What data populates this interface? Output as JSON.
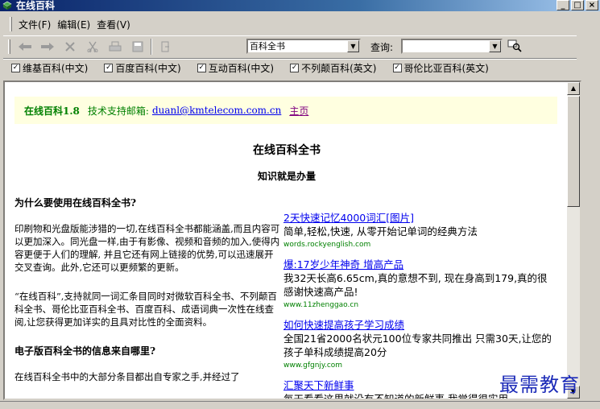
{
  "window": {
    "title": "在线百科",
    "controls": [
      "_",
      "□",
      "×"
    ]
  },
  "menu": [
    "文件(F)",
    "编辑(E)",
    "查看(V)"
  ],
  "toolbar": {
    "icons": [
      "back-icon",
      "forward-icon",
      "stop-icon",
      "cut-icon",
      "print-icon",
      "save-icon",
      "exit-icon"
    ],
    "encyclopedia_select": "百科全书",
    "query_label": "查询:",
    "query_value": ""
  },
  "sources": [
    {
      "label": "维基百科(中文)",
      "checked": true
    },
    {
      "label": "百度百科(中文)",
      "checked": true
    },
    {
      "label": "互动百科(中文)",
      "checked": true
    },
    {
      "label": "不列颠百科(英文)",
      "checked": true
    },
    {
      "label": "哥伦比亚百科(英文)",
      "checked": true
    }
  ],
  "info": {
    "app_name": "在线百科1.8",
    "support_label": "技术支持邮箱:",
    "email": "duanl@kmtelecom.com.cn",
    "home": "主页"
  },
  "doc": {
    "title": "在线百科全书",
    "subtitle": "知识就是办量",
    "q1": "为什么要使用在线百科全书?",
    "p1": "印刷物和光盘版能涉猎的一切,在线百科全书都能涵盖,而且内容可以更加深入。同光盘一样,由于有影像、视频和音频的加入,使得内容更便于人们的理解, 并且它还有网上链接的优势,可以迅速展开交叉查询。此外,它还可以更频繁的更新。",
    "p2": "“在线百科”,支持就同一词汇条目同时对微软百科全书、不列颠百科全书、哥伦比亚百科全书、百度百科、成语词典一次性在线查阅,让您获得更加详实的且具对比性的全面资料。",
    "q2": "电子版百科全书的信息来自哪里?",
    "p3": "在线百科全书中的大部分条目都出自专家之手,并经过了"
  },
  "ads": [
    {
      "title": "2天快速记忆4000词汇[图片]",
      "desc": "简单,轻松,快速, 从零开始记单词的经典方法",
      "url": "words.rockyenglish.com"
    },
    {
      "title": "爆:17岁少年神奇 增高产品",
      "desc": "我32天长高6.65cm,真的意想不到, 现在身高到179,真的很感谢快速高产品!",
      "url": "www.11zhenggao.cn"
    },
    {
      "title": "如何快速提高孩子学习成绩",
      "desc": "全国21省2000名状元100位专家共同推出 只需30天,让您的孩子单科成绩提高20分",
      "url": "www.gfgnjy.com"
    },
    {
      "title": "汇聚天下新鲜事",
      "desc": "每天看看这里就没有不知道的新鲜事 我觉得很实用",
      "url": ""
    }
  ],
  "watermark": "最需教育"
}
